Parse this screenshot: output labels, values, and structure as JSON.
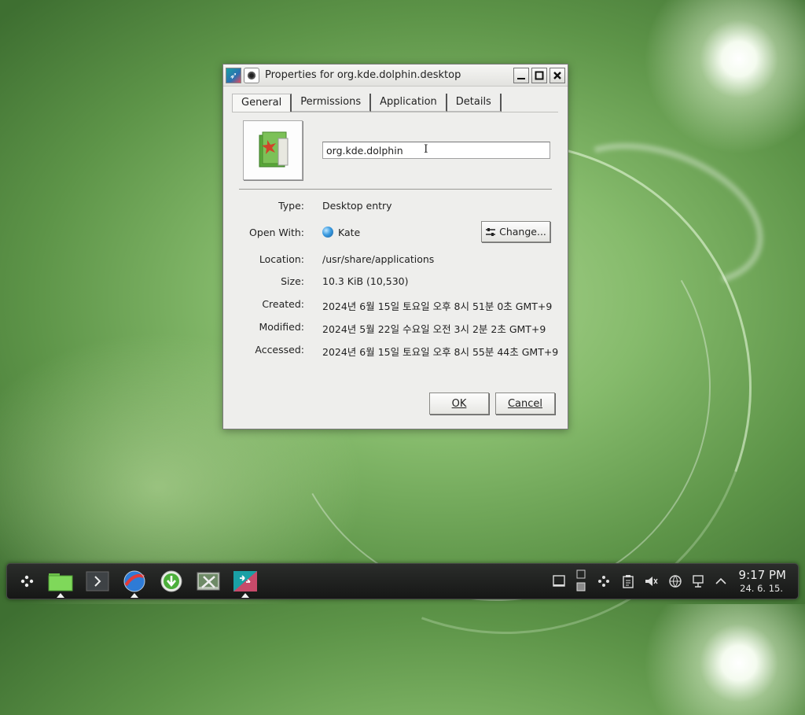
{
  "window": {
    "title": "Properties for org.kde.dolphin.desktop",
    "minimize_label": "_",
    "maximize_label": "□",
    "close_label": "✕"
  },
  "tabs": [
    {
      "label": "General",
      "active": true
    },
    {
      "label": "Permissions",
      "active": false
    },
    {
      "label": "Application",
      "active": false
    },
    {
      "label": "Details",
      "active": false
    }
  ],
  "general": {
    "name_value": "org.kde.dolphin",
    "type_label": "Type:",
    "type_value": "Desktop entry",
    "open_with_label": "Open With:",
    "open_with_value": "Kate",
    "change_button": "Change...",
    "location_label": "Location:",
    "location_value": "/usr/share/applications",
    "size_label": "Size:",
    "size_value": "10.3 KiB (10,530)",
    "created_label": "Created:",
    "created_value": "2024년 6월 15일 토요일 오후 8시 51분 0초 GMT+9",
    "modified_label": "Modified:",
    "modified_value": "2024년 5월 22일 수요일 오전 3시 2분 2초 GMT+9",
    "accessed_label": "Accessed:",
    "accessed_value": "2024년 6월 15일 토요일 오후 8시 55분 44초 GMT+9"
  },
  "buttons": {
    "ok": "OK",
    "cancel": "Cancel"
  },
  "taskbar": {
    "apps": [
      "launcher-icon",
      "file-manager-icon",
      "terminal-icon",
      "browser-icon",
      "download-icon",
      "settings-tools-icon",
      "app-icon"
    ],
    "clock_time": "9:17 PM",
    "clock_date": "24. 6. 15."
  },
  "colors": {
    "accent": "#3a9be0",
    "taskbar_bg": "#1e1f1e",
    "dialog_bg": "#eeeeec"
  }
}
